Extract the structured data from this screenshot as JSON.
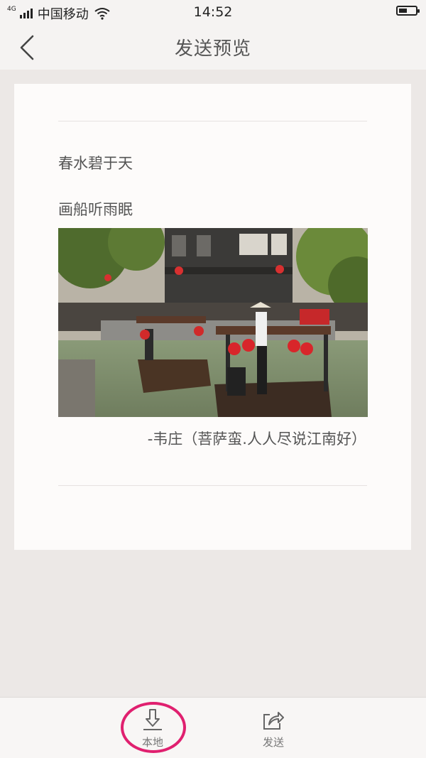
{
  "status_bar": {
    "network_type": "4G",
    "carrier": "中国移动",
    "time": "14:52",
    "battery_level": 0.5
  },
  "nav": {
    "title": "发送预览",
    "back_icon": "chevron-left-icon"
  },
  "content": {
    "lines": [
      "春水碧于天",
      "画船听雨眠"
    ],
    "photo_description_icon": "photo-canal-boats",
    "credit": "-韦庄（菩萨蛮.人人尽说江南好）"
  },
  "bottom_bar": {
    "local": {
      "label": "本地",
      "icon": "download-icon"
    },
    "send": {
      "label": "发送",
      "icon": "share-icon"
    }
  },
  "colors": {
    "highlight_circle": "#e0206f",
    "background": "#ece8e6",
    "card": "#fdfbfa"
  }
}
